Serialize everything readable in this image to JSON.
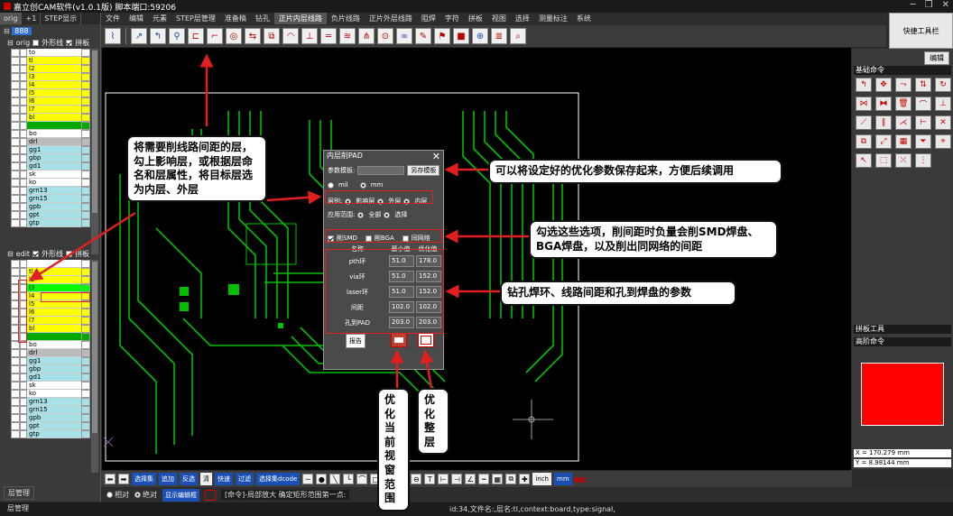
{
  "window": {
    "title": "嘉立创CAM软件(v1.0.1版) 脚本端口:59206"
  },
  "left_panel": {
    "tabs": [
      "orig",
      "+1",
      "STEP显示"
    ],
    "root_node": "888",
    "orig_header": {
      "name": "orig",
      "outline_label": "外形线",
      "panel_label": "拼板"
    },
    "orig_layers": [
      {
        "name": "to",
        "color": "#ffffff"
      },
      {
        "name": "tl",
        "color": "#ffff00"
      },
      {
        "name": "l2",
        "color": "#ffff00"
      },
      {
        "name": "l3",
        "color": "#ffff00"
      },
      {
        "name": "l4",
        "color": "#ffff00"
      },
      {
        "name": "l5",
        "color": "#ffff00"
      },
      {
        "name": "l6",
        "color": "#ffff00"
      },
      {
        "name": "l7",
        "color": "#ffff00"
      },
      {
        "name": "bl",
        "color": "#ffff00"
      },
      {
        "name": "",
        "color": "#00aa00"
      },
      {
        "name": "bo",
        "color": "#ffffff"
      },
      {
        "name": "drl",
        "color": "#bbbbbb"
      },
      {
        "name": "gg1",
        "color": "#a8e0e8"
      },
      {
        "name": "gbp",
        "color": "#a8e0e8"
      },
      {
        "name": "gd1",
        "color": "#a8e0e8"
      },
      {
        "name": "sk",
        "color": "#ffffff"
      },
      {
        "name": "ko",
        "color": "#ffffff"
      },
      {
        "name": "grn13",
        "color": "#a8e0e8"
      },
      {
        "name": "grn15",
        "color": "#a8e0e8"
      },
      {
        "name": "gpb",
        "color": "#a8e0e8"
      },
      {
        "name": "gpt",
        "color": "#a8e0e8"
      },
      {
        "name": "gtp",
        "color": "#a8e0e8"
      }
    ],
    "edit_header": {
      "name": "edit",
      "outline_label": "外形线",
      "panel_label": "拼板"
    },
    "edit_layers": [
      {
        "name": "",
        "color": "#ffffff"
      },
      {
        "name": "tl",
        "color": "#ffff00"
      },
      {
        "name": "l2",
        "color": "#ffff00"
      },
      {
        "name": "l3",
        "color": "#00ff00"
      },
      {
        "name": "l4",
        "color": "#ffff00"
      },
      {
        "name": "l5",
        "color": "#ffff00"
      },
      {
        "name": "l6",
        "color": "#ffff00"
      },
      {
        "name": "l7",
        "color": "#ffff00"
      },
      {
        "name": "bl",
        "color": "#ffff00"
      },
      {
        "name": "",
        "color": "#00aa00"
      },
      {
        "name": "bo",
        "color": "#ffffff"
      },
      {
        "name": "drl",
        "color": "#bbbbbb"
      },
      {
        "name": "gg1",
        "color": "#a8e0e8"
      },
      {
        "name": "gbp",
        "color": "#a8e0e8"
      },
      {
        "name": "gd1",
        "color": "#a8e0e8"
      },
      {
        "name": "sk",
        "color": "#ffffff"
      },
      {
        "name": "ko",
        "color": "#ffffff"
      },
      {
        "name": "grn13",
        "color": "#a8e0e8"
      },
      {
        "name": "grn15",
        "color": "#a8e0e8"
      },
      {
        "name": "gpb",
        "color": "#a8e0e8"
      },
      {
        "name": "gpt",
        "color": "#a8e0e8"
      },
      {
        "name": "gtp",
        "color": "#a8e0e8"
      }
    ],
    "bottom_label": "层管理"
  },
  "menu": [
    "文件",
    "编辑",
    "元素",
    "STEP层管理",
    "准备稿",
    "钻孔",
    "正片内层线路",
    "负片线路",
    "正片外层线路",
    "阻焊",
    "字符",
    "拼板",
    "视图",
    "选择",
    "测量标注",
    "系统"
  ],
  "menu_active": "正片内层线路",
  "quick_tools_label": "快捷工具栏",
  "right_panel": {
    "edit_label": "编辑",
    "basic_title": "基础命令",
    "panel_tools_title": "拼板工具",
    "advanced_title": "高阶命令",
    "coord_x": "X = 170.279 mm",
    "coord_y": "Y = 8.98144 mm"
  },
  "dialog": {
    "title": "内层削PAD",
    "template_label": "参数模板:",
    "save_button": "另存模板",
    "unit_mil": "mil",
    "unit_mm": "mm",
    "layer_label": "层别:",
    "layer_opt1": "影响层",
    "layer_opt2": "外层",
    "layer_opt3": "内层",
    "range_label": "应用范围:",
    "range_opt1": "全部",
    "range_opt2": "选择",
    "cut_smd": "削SMD",
    "cut_bga": "削BGA",
    "same_net": "同网络",
    "col_name": "名称",
    "col_min": "最小值",
    "col_opt": "优化值",
    "rows": [
      {
        "name": "pth环",
        "min": "51.0",
        "opt": "178.0"
      },
      {
        "name": "via环",
        "min": "51.0",
        "opt": "152.0"
      },
      {
        "name": "laser环",
        "min": "51.0",
        "opt": "152.0"
      },
      {
        "name": "间距",
        "min": "102.0",
        "opt": "102.0"
      },
      {
        "name": "孔到PAD",
        "min": "203.0",
        "opt": "203.0"
      }
    ],
    "report_button": "报告"
  },
  "bottom_toolbar": {
    "select_btn": "选择集",
    "add_btn": "追加",
    "reverse_btn": "反选",
    "clear_btn": "清",
    "quick_btn": "快速",
    "filter_btn": "过滤",
    "dcode_btn": "选择集dcode",
    "unit_inch": "inch",
    "unit_mm": "mm"
  },
  "cmd": {
    "relative": "相对",
    "absolute": "绝对",
    "display_edit": "显示编辑框",
    "command_text": "[命令]-局部放大 确定矩形范围第一点:"
  },
  "status_text": "id:34,文件名:,层名:tl,context:board,type:signal,",
  "callouts": {
    "c1": "将需要削线路间距的层，勾上影响层，或根据层命名和层属性，将目标层选为内层、外层",
    "c2": "可以将设定好的优化参数保存起来，方便后续调用",
    "c3": "勾选这些选项，削间距时负量会削SMD焊盘、BGA焊盘，以及削出同网络的间距",
    "c4": "钻孔焊环、线路间距和孔到焊盘的参数",
    "c5": "优化当前视窗范围",
    "c6": "优化整层"
  }
}
